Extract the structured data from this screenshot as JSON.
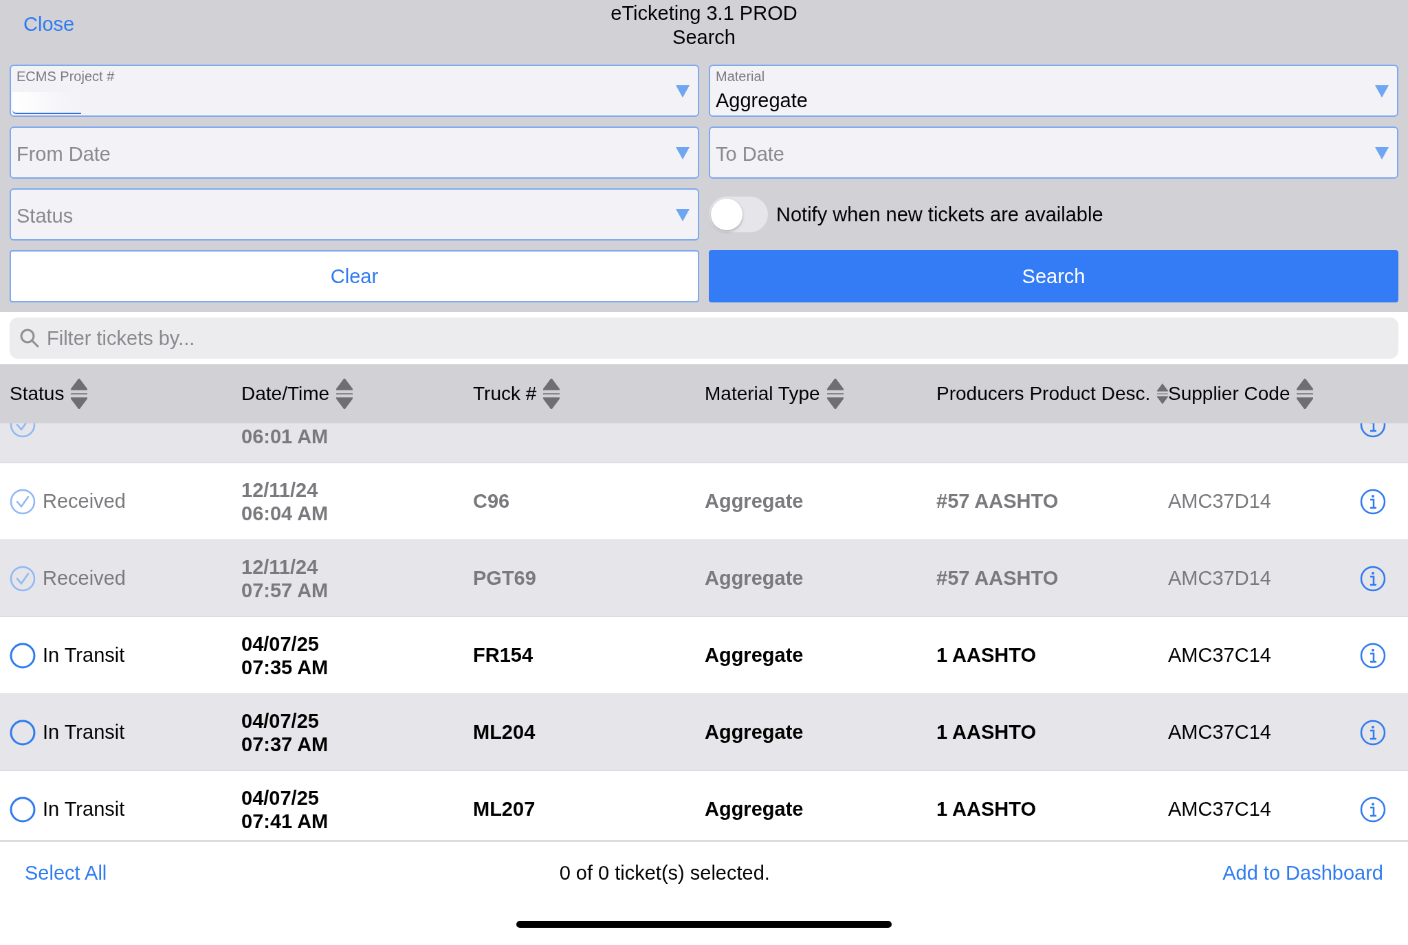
{
  "nav": {
    "close": "Close",
    "title": "eTicketing 3.1 PROD",
    "subtitle": "Search"
  },
  "fields": [
    {
      "label": "ECMS Project #"
    },
    {
      "label": "Material",
      "value": "Aggregate"
    },
    {
      "placeholder": "From Date"
    },
    {
      "placeholder": "To Date"
    },
    {
      "placeholder": "Status"
    }
  ],
  "notify": {
    "label": "Notify when new tickets are available",
    "on": false
  },
  "buttons": {
    "clear": "Clear",
    "search": "Search"
  },
  "filter": {
    "placeholder": "Filter tickets by..."
  },
  "table": {
    "columns": [
      "Status",
      "Date/Time",
      "Truck #",
      "Material Type",
      "Producers Product Desc.",
      "Supplier Code"
    ],
    "rows": [
      {
        "kind": "received",
        "time": "06:01 AM",
        "partial": true
      },
      {
        "kind": "received",
        "status": "Received",
        "date": "12/11/24",
        "time": "06:04 AM",
        "truck": "C96",
        "material": "Aggregate",
        "desc": "#57 AASHTO",
        "supplier": "AMC37D14"
      },
      {
        "kind": "received",
        "status": "Received",
        "date": "12/11/24",
        "time": "07:57 AM",
        "truck": "PGT69",
        "material": "Aggregate",
        "desc": "#57 AASHTO",
        "supplier": "AMC37D14"
      },
      {
        "kind": "in_transit",
        "status": "In Transit",
        "date": "04/07/25",
        "time": "07:35 AM",
        "truck": "FR154",
        "material": "Aggregate",
        "desc": "1 AASHTO",
        "supplier": "AMC37C14"
      },
      {
        "kind": "in_transit",
        "status": "In Transit",
        "date": "04/07/25",
        "time": "07:37 AM",
        "truck": "ML204",
        "material": "Aggregate",
        "desc": "1 AASHTO",
        "supplier": "AMC37C14"
      },
      {
        "kind": "in_transit",
        "status": "In Transit",
        "date": "04/07/25",
        "time": "07:41 AM",
        "truck": "ML207",
        "material": "Aggregate",
        "desc": "1 AASHTO",
        "supplier": "AMC37C14"
      }
    ]
  },
  "footer": {
    "select_all": "Select All",
    "count": "0 of 0 ticket(s) selected.",
    "add": "Add to Dashboard"
  }
}
